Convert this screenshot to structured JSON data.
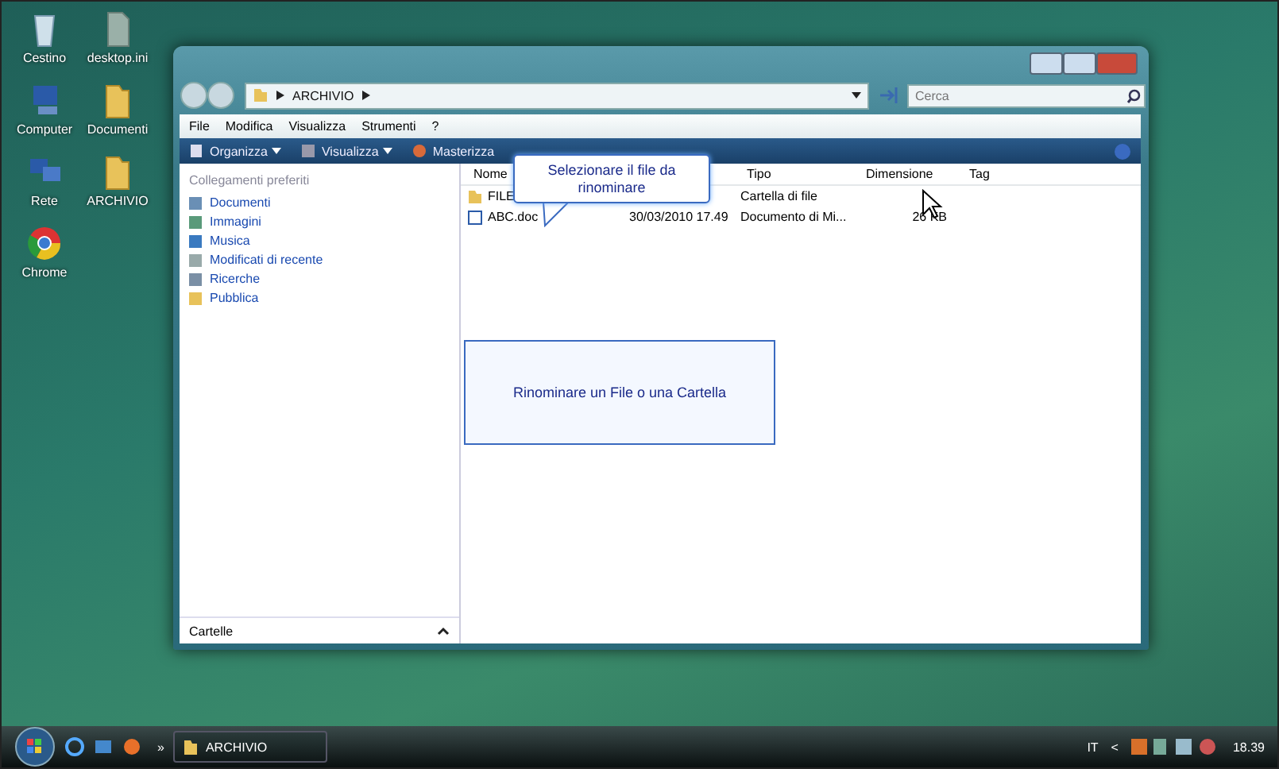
{
  "desktop_icons": [
    {
      "label": "Cestino",
      "kind": "bin"
    },
    {
      "label": "desktop.ini",
      "kind": "file"
    },
    {
      "label": "Computer",
      "kind": "computer"
    },
    {
      "label": "Documenti",
      "kind": "folder"
    },
    {
      "label": "Rete",
      "kind": "network"
    },
    {
      "label": "ARCHIVIO",
      "kind": "folder"
    },
    {
      "label": "Chrome",
      "kind": "browser"
    }
  ],
  "window": {
    "address": [
      "ARCHIVIO"
    ],
    "search": {
      "placeholder": "Cerca"
    },
    "menu": [
      "File",
      "Modifica",
      "Visualizza",
      "Strumenti",
      "?"
    ],
    "toolbar": [
      {
        "label": "Organizza",
        "kind": "organize"
      },
      {
        "label": "Visualizza",
        "kind": "views"
      },
      {
        "label": "Masterizza",
        "kind": "burn"
      }
    ],
    "favorites_title": "Collegamenti preferiti",
    "favorites": [
      {
        "label": "Documenti",
        "kind": "docs"
      },
      {
        "label": "Immagini",
        "kind": "pictures"
      },
      {
        "label": "Musica",
        "kind": "music"
      },
      {
        "label": "Modificati di recente",
        "kind": "recent"
      },
      {
        "label": "Ricerche",
        "kind": "search"
      },
      {
        "label": "Pubblica",
        "kind": "folder"
      }
    ],
    "folders_label": "Cartelle",
    "columns": [
      "Nome",
      "",
      "Tipo",
      "Dimensione",
      "Tag"
    ],
    "rows": [
      {
        "kind": "folder",
        "name": "FILE",
        "date": "",
        "type": "Cartella di file",
        "size": ""
      },
      {
        "kind": "doc",
        "name": "ABC.doc",
        "date": "30/03/2010 17.49",
        "type": "Documento di Mi...",
        "size": "26 KB"
      }
    ]
  },
  "callout": "Selezionare il file da rinominare",
  "caption": "Rinominare un File o una Cartella",
  "taskbar": {
    "task": "ARCHIVIO",
    "language": "IT",
    "chevron": "<",
    "clock": "18.39",
    "overflow": "»"
  }
}
